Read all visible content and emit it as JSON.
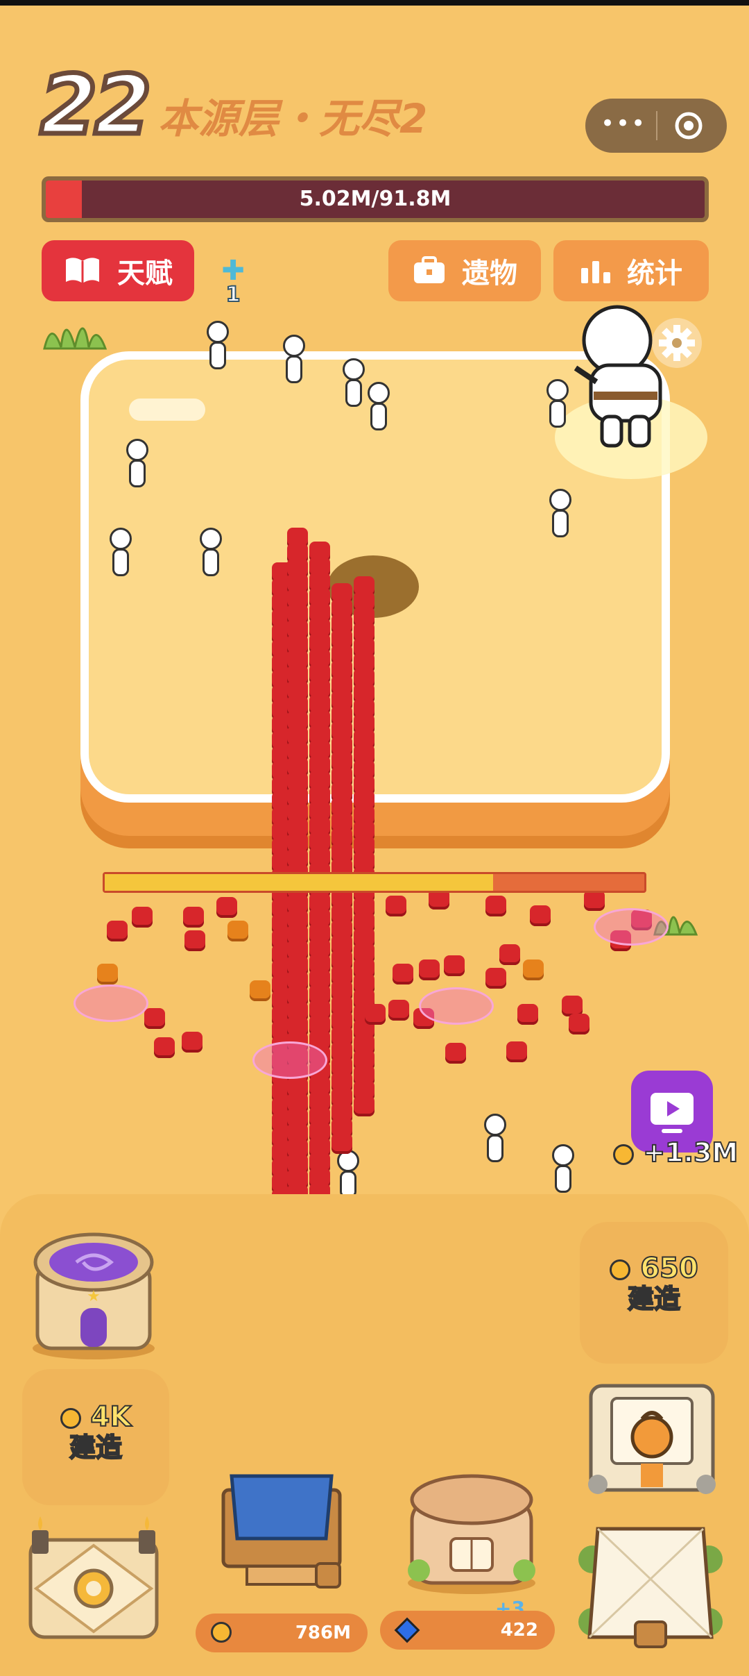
{
  "level": {
    "number": "22",
    "name": "本源层・无尽2"
  },
  "menu_capsule": {
    "more_icon": "more-dots-icon",
    "close_icon": "target-icon"
  },
  "hp_bar": {
    "text": "5.02M/91.8M",
    "fill_fraction": 0.055,
    "fill_color": "#e8403e",
    "track_color": "#6b2d37"
  },
  "buttons": {
    "talent": {
      "label": "天赋",
      "icon": "book-icon",
      "color": "#e4343d"
    },
    "relics": {
      "label": "遗物",
      "icon": "briefcase-icon",
      "color": "#f39a4a"
    },
    "stats": {
      "label": "统计",
      "icon": "bar-chart-icon",
      "color": "#f39a4a"
    }
  },
  "cross_badge": {
    "count": "1",
    "icon": "cross-icon"
  },
  "settings": {
    "icon": "gear-icon"
  },
  "boss_bar": {
    "fill_fraction": 0.72
  },
  "ad_reward": {
    "icon": "tv-play-icon",
    "text": "+1.3M"
  },
  "build_slots": [
    {
      "cost": "650",
      "label": "建造"
    },
    {
      "cost": "4K",
      "label": "建造"
    }
  ],
  "resources": {
    "gold": {
      "value": "786M",
      "icon": "coin-icon"
    },
    "gems": {
      "value": "422",
      "icon": "gem-icon",
      "delta": "+3"
    }
  },
  "buildings": [
    "portal-tower-icon",
    "training-tent-icon",
    "library-tower-icon",
    "altar-icon",
    "kettlebell-gym-icon",
    "camp-tent-icon"
  ]
}
